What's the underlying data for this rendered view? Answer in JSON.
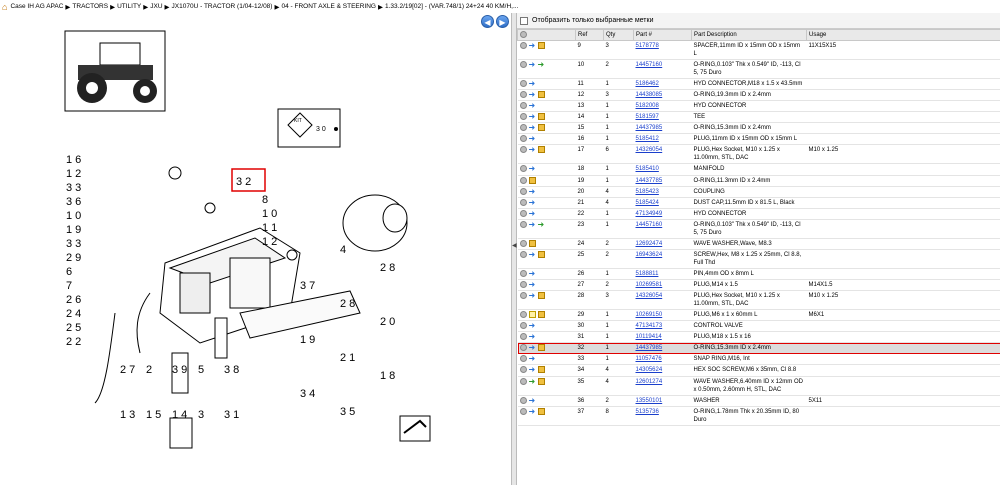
{
  "breadcrumb": {
    "items": [
      "Case IH AG APAC",
      "TRACTORS",
      "UTILITY",
      "JXU",
      "JX1070U - TRACTOR (1/04-12/08)",
      "04 - FRONT AXLE & STEERING",
      "1.33.2/19[02] - (VAR.748/1) 24+24 40 KM/H,..."
    ]
  },
  "diagram": {
    "kit_label": "KIT",
    "kit_note": "3 0",
    "highlight_ref": "3 2",
    "callouts_left": [
      "1 6",
      "1 2",
      "3 3",
      "3 6",
      "1 0",
      "1 9",
      "3 3",
      "2 9",
      "6",
      "7",
      "2 6",
      "2 4",
      "2 5",
      "2 2"
    ],
    "callouts_right": [
      "8",
      "1 0",
      "1 1",
      "1 2",
      "4",
      "2 8",
      "3 7",
      "2 8",
      "2 0",
      "1 9",
      "2 1",
      "1 8",
      "3 4",
      "3 5"
    ],
    "callouts_bottom": [
      "2 7",
      "2",
      "3 9",
      "5",
      "3 8",
      "1 3",
      "1 5",
      "1 4",
      "3",
      "3 1"
    ]
  },
  "filter": {
    "label": "Отобразить только выбранные метки"
  },
  "columns": [
    "Ref",
    "Qty",
    "Part #",
    "Part Description",
    "Usage"
  ],
  "rows": [
    {
      "ref": "9",
      "qty": "3",
      "part": "5178778",
      "desc": "SPACER,11mm ID x 15mm OD x 15mm L",
      "usage": "11X15X15",
      "icons": [
        "view",
        "info",
        "box"
      ]
    },
    {
      "ref": "10",
      "qty": "2",
      "part": "14457160",
      "desc": "O-RING,0.103\" Thk x 0.549\" ID, -113, Cl 5, 75 Duro",
      "usage": "",
      "icons": [
        "view",
        "info",
        "swap"
      ]
    },
    {
      "ref": "11",
      "qty": "1",
      "part": "5186462",
      "desc": "HYD CONNECTOR,M18 x 1.5 x 43.5mm",
      "usage": "",
      "icons": [
        "view",
        "info"
      ]
    },
    {
      "ref": "12",
      "qty": "3",
      "part": "14438085",
      "desc": "O-RING,19.3mm ID x 2.4mm",
      "usage": "",
      "icons": [
        "view",
        "info",
        "box"
      ]
    },
    {
      "ref": "13",
      "qty": "1",
      "part": "5182008",
      "desc": "HYD CONNECTOR",
      "usage": "",
      "icons": [
        "view",
        "info"
      ]
    },
    {
      "ref": "14",
      "qty": "1",
      "part": "5181597",
      "desc": "TEE",
      "usage": "",
      "icons": [
        "view",
        "info",
        "box"
      ]
    },
    {
      "ref": "15",
      "qty": "1",
      "part": "14437985",
      "desc": "O-RING,15.3mm ID x 2.4mm",
      "usage": "",
      "icons": [
        "view",
        "info",
        "box"
      ]
    },
    {
      "ref": "16",
      "qty": "1",
      "part": "5185412",
      "desc": "PLUG,11mm ID x 15mm OD x 15mm L",
      "usage": "",
      "icons": [
        "view",
        "info"
      ]
    },
    {
      "ref": "17",
      "qty": "6",
      "part": "14326054",
      "desc": "PLUG,Hex Socket, M10 x 1.25 x 11.00mm, STL, DAC",
      "usage": "M10 x 1.25",
      "icons": [
        "view",
        "info",
        "box"
      ]
    },
    {
      "ref": "18",
      "qty": "1",
      "part": "5185410",
      "desc": "MANIFOLD",
      "usage": "",
      "icons": [
        "view",
        "info"
      ]
    },
    {
      "ref": "19",
      "qty": "1",
      "part": "14437785",
      "desc": "O-RING,11.3mm ID x 2.4mm",
      "usage": "",
      "icons": [
        "view",
        "box"
      ]
    },
    {
      "ref": "20",
      "qty": "4",
      "part": "5185423",
      "desc": "COUPLING",
      "usage": "",
      "icons": [
        "view",
        "info"
      ]
    },
    {
      "ref": "21",
      "qty": "4",
      "part": "5185424",
      "desc": "DUST CAP,11.5mm ID x 81.5 L, Black",
      "usage": "",
      "icons": [
        "view",
        "info"
      ]
    },
    {
      "ref": "22",
      "qty": "1",
      "part": "47134949",
      "desc": "HYD CONNECTOR",
      "usage": "",
      "icons": [
        "view",
        "info"
      ]
    },
    {
      "ref": "23",
      "qty": "1",
      "part": "14457160",
      "desc": "O-RING,0.103\" Thk x 0.549\" ID, -113, Cl 5, 75 Duro",
      "usage": "",
      "icons": [
        "view",
        "info",
        "swap"
      ]
    },
    {
      "ref": "24",
      "qty": "2",
      "part": "12692474",
      "desc": "WAVE WASHER,Wave, M8.3",
      "usage": "",
      "icons": [
        "view",
        "box"
      ]
    },
    {
      "ref": "25",
      "qty": "2",
      "part": "16943624",
      "desc": "SCREW,Hex, M8 x 1.25 x 25mm, Cl 8.8, Full Thd",
      "usage": "",
      "icons": [
        "view",
        "info",
        "box"
      ]
    },
    {
      "ref": "26",
      "qty": "1",
      "part": "5188811",
      "desc": "PIN,4mm OD x 8mm L",
      "usage": "",
      "icons": [
        "view",
        "info"
      ]
    },
    {
      "ref": "27",
      "qty": "2",
      "part": "10269581",
      "desc": "PLUG,M14 x 1.5",
      "usage": "M14X1.5",
      "icons": [
        "view",
        "info"
      ]
    },
    {
      "ref": "28",
      "qty": "3",
      "part": "14326054",
      "desc": "PLUG,Hex Socket, M10 x 1.25 x 11.00mm, STL, DAC",
      "usage": "M10 x 1.25",
      "icons": [
        "view",
        "info",
        "box"
      ]
    },
    {
      "ref": "29",
      "qty": "1",
      "part": "10269150",
      "desc": "PLUG,M6 x 1 x 60mm L",
      "usage": "M6X1",
      "icons": [
        "view",
        "note",
        "box"
      ]
    },
    {
      "ref": "30",
      "qty": "1",
      "part": "47134173",
      "desc": "CONTROL VALVE",
      "usage": "",
      "icons": [
        "view",
        "info"
      ]
    },
    {
      "ref": "31",
      "qty": "1",
      "part": "10119414",
      "desc": "PLUG,M18 x 1.5 x 16",
      "usage": "",
      "icons": [
        "view",
        "info"
      ]
    },
    {
      "ref": "32",
      "qty": "1",
      "part": "14437985",
      "desc": "O-RING,15.3mm ID x 2.4mm",
      "usage": "",
      "icons": [
        "view",
        "info",
        "box"
      ],
      "highlight": true
    },
    {
      "ref": "33",
      "qty": "1",
      "part": "11057476",
      "desc": "SNAP RING,M16, Int",
      "usage": "",
      "icons": [
        "view",
        "info"
      ]
    },
    {
      "ref": "34",
      "qty": "4",
      "part": "14305624",
      "desc": "HEX SOC SCREW,M6 x 35mm, Cl 8.8",
      "usage": "",
      "icons": [
        "view",
        "info",
        "box"
      ]
    },
    {
      "ref": "35",
      "qty": "4",
      "part": "12601274",
      "desc": "WAVE WASHER,6.40mm ID x 12mm OD x 0.50mm, 2.60mm H, STL, DAC",
      "usage": "",
      "icons": [
        "view",
        "swap",
        "box"
      ]
    },
    {
      "ref": "36",
      "qty": "2",
      "part": "13550101",
      "desc": "WASHER",
      "usage": "5X11",
      "icons": [
        "view",
        "info"
      ]
    },
    {
      "ref": "37",
      "qty": "8",
      "part": "5135736",
      "desc": "O-RING,1.78mm Thk x 20.35mm ID, 80 Duro",
      "usage": "",
      "icons": [
        "view",
        "info",
        "box"
      ]
    }
  ]
}
